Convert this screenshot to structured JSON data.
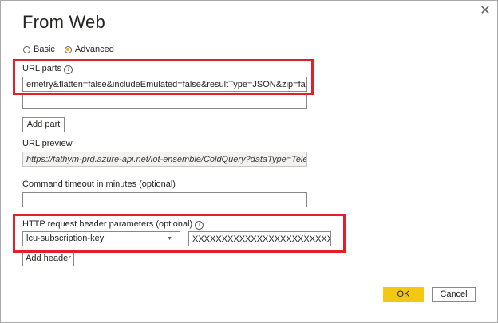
{
  "dialog": {
    "title": "From Web",
    "close_icon": "close-icon"
  },
  "mode": {
    "options": [
      {
        "label": "Basic",
        "selected": false
      },
      {
        "label": "Advanced",
        "selected": true
      }
    ]
  },
  "url_parts": {
    "label": "URL parts",
    "part1_value": "emetry&flatten=false&includeEmulated=false&resultType=JSON&zip=false",
    "part2_value": "",
    "add_part_label": "Add part"
  },
  "url_preview": {
    "label": "URL preview",
    "value": "https://fathym-prd.azure-api.net/iot-ensemble/ColdQuery?dataType=Teleme"
  },
  "timeout": {
    "label": "Command timeout in minutes (optional)",
    "value": ""
  },
  "headers": {
    "label": "HTTP request header parameters (optional)",
    "key_value": "lcu-subscription-key",
    "value": "XXXXXXXXXXXXXXXXXXXXXXXXXXXXXX",
    "add_header_label": "Add header"
  },
  "footer": {
    "ok_label": "OK",
    "cancel_label": "Cancel"
  },
  "colors": {
    "accent": "#f2c811",
    "highlight": "#e0202a"
  }
}
